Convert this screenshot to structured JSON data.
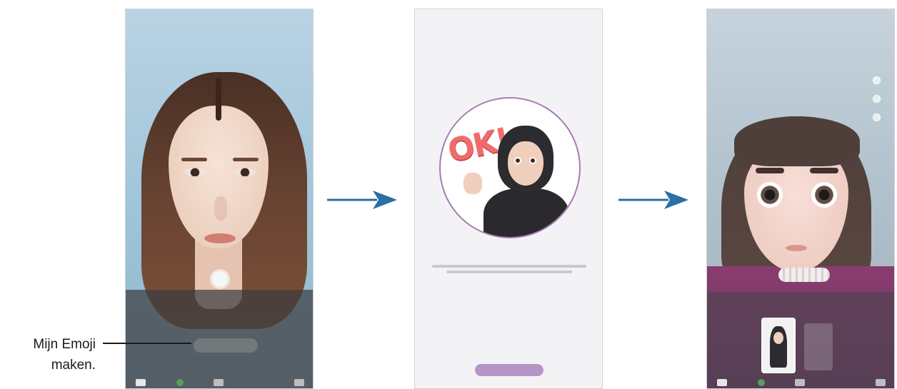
{
  "callout": {
    "line1": "Mijn Emoji",
    "line2": "maken."
  },
  "colors": {
    "arrow": "#2d6fa3",
    "accent": "#b595c7",
    "circle_border": "#a67cb0"
  },
  "screen1": {
    "shutter_icon": "shutter-icon",
    "nav_icons": [
      "gallery-icon",
      "effect-icon",
      "mode-icon",
      "switch-camera-icon"
    ]
  },
  "screen2": {
    "sticker_text": "OK!"
  },
  "screen3": {
    "side_icons": [
      "camera-mode-icon",
      "filter-icon",
      "stickers-icon"
    ],
    "nav_icons": [
      "gallery-icon",
      "effect-icon",
      "mode-icon",
      "switch-camera-icon"
    ]
  }
}
